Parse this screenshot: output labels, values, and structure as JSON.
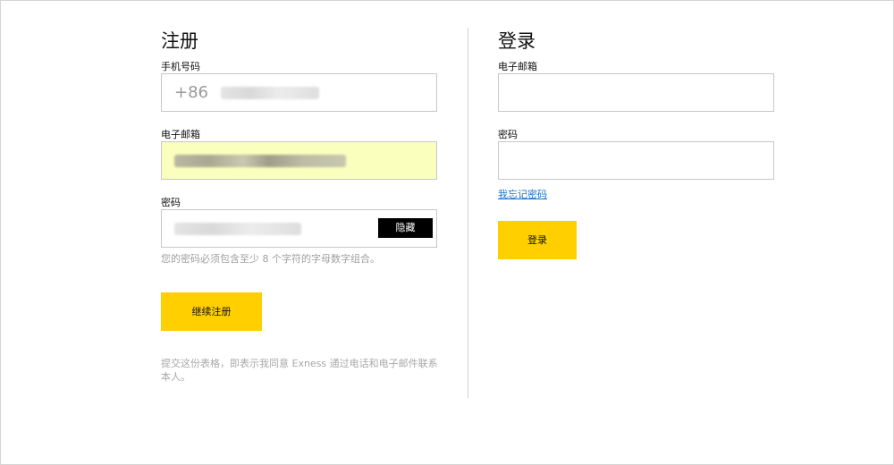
{
  "register": {
    "title": "注册",
    "phone_label": "手机号码",
    "phone_prefix": "+86",
    "email_label": "电子邮箱",
    "password_label": "密码",
    "hide_label": "隐藏",
    "password_hint": "您的密码必须包含至少 8 个字符的字母数字组合。",
    "continue_label": "继续注册",
    "legal_text": "提交这份表格，即表示我同意 Exness 通过电话和电子邮件联系本人。"
  },
  "login": {
    "title": "登录",
    "email_label": "电子邮箱",
    "password_label": "密码",
    "forgot_label": "我忘记密码",
    "login_label": "登录"
  },
  "colors": {
    "accent": "#ffcf00",
    "autofill": "#faffbd",
    "link": "#1a73c9"
  }
}
